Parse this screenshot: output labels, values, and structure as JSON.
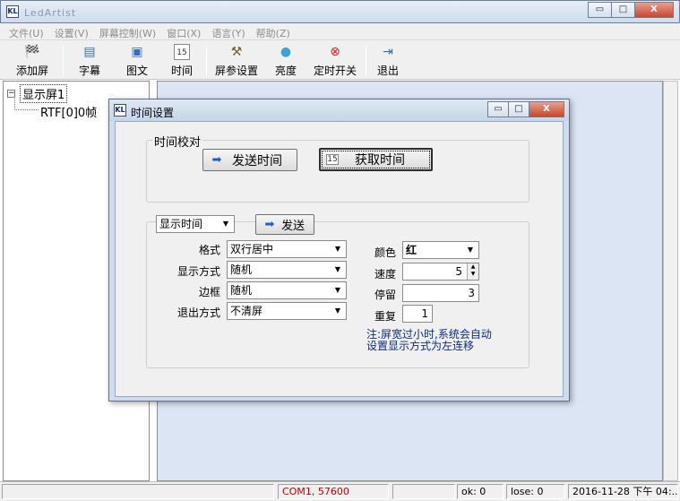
{
  "app": {
    "title": "LedArtist",
    "icon": "ledartist-app-icon"
  },
  "window_controls": {
    "minimize": "▭",
    "maximize": "□",
    "close": "X"
  },
  "menu": [
    "文件(U)",
    "设置(V)",
    "屏幕控制(W)",
    "窗口(X)",
    "语言(Y)",
    "帮助(Z)"
  ],
  "toolbar": {
    "add_screen": "添加屏",
    "subtitle": "字幕",
    "image_text": "图文",
    "time": "时间",
    "screen_params": "屏参设置",
    "brightness": "亮度",
    "timer_switch": "定时开关",
    "exit": "退出"
  },
  "tree": {
    "root": "显示屏1",
    "child": "RTF[0]0帧",
    "expander": "−"
  },
  "dialog": {
    "title": "时间设置",
    "group_calibrate": "时间校对",
    "send_time": "发送时间",
    "get_time": "获取时间",
    "mode_select": "显示时间",
    "send": "发送",
    "format_label": "格式",
    "format_value": "双行居中",
    "display_mode_label": "显示方式",
    "display_mode_value": "随机",
    "border_label": "边框",
    "border_value": "随机",
    "exit_mode_label": "退出方式",
    "exit_mode_value": "不清屏",
    "color_label": "颜色",
    "color_value": "红",
    "speed_label": "速度",
    "speed_value": "5",
    "stay_label": "停留",
    "stay_value": "3",
    "repeat_label": "重复",
    "repeat_value": "1",
    "note_line1": "注:屏宽过小时,系统会自动",
    "note_line2": "设置显示方式为左连移"
  },
  "status": {
    "port": "COM1, 57600",
    "ok": "ok: 0",
    "lose": "lose: 0",
    "datetime": "2016-11-28 下午 04:.."
  },
  "colors": {
    "port_text": "#c00000",
    "workspace": "#dbe5f3",
    "note": "#0b2c7a"
  }
}
